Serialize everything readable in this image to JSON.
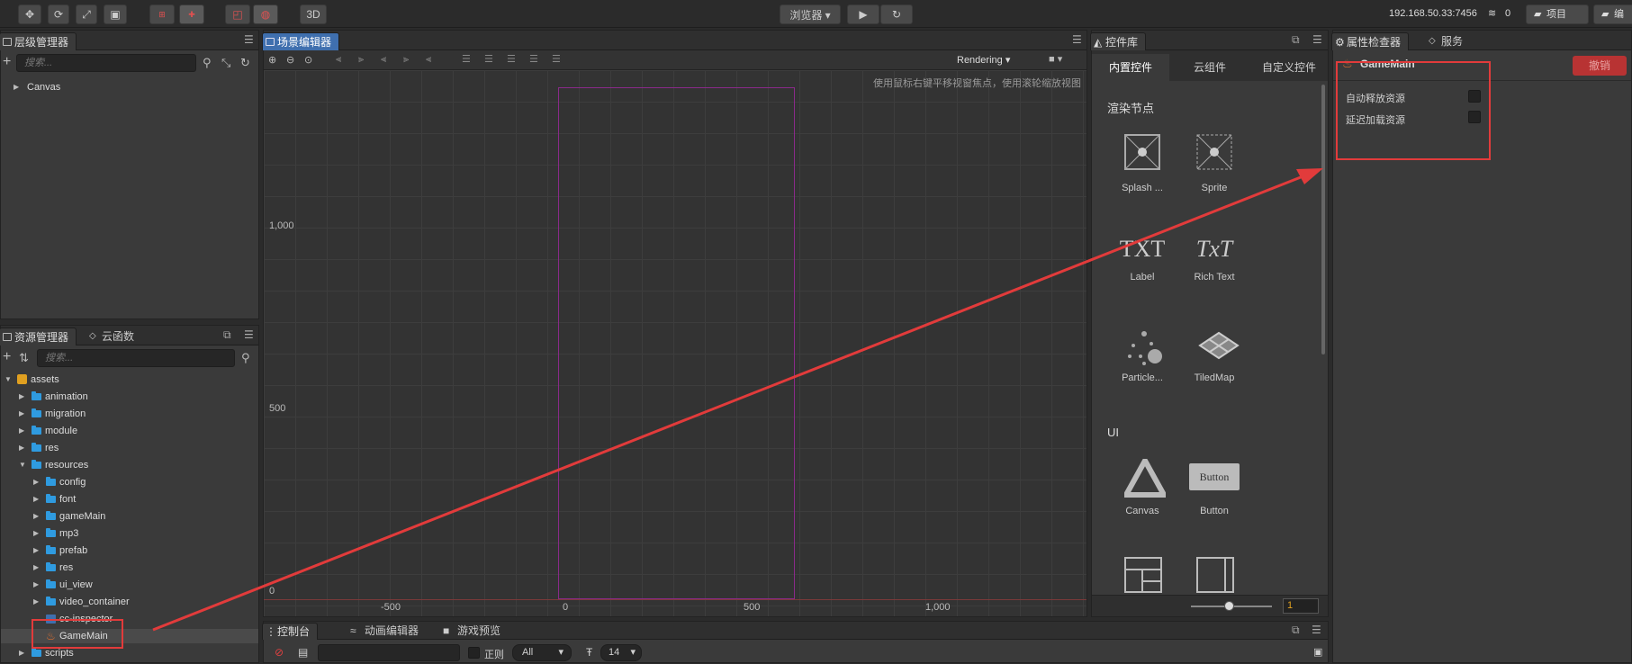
{
  "toolbar": {
    "btn_3d": "3D",
    "browser_label": "浏览器 ▾",
    "ip": "192.168.50.33:7456",
    "wifi_count": "0",
    "project_label": "项目",
    "edit_label": "编"
  },
  "hierarchy": {
    "tab": "层级管理器",
    "search_placeholder": "搜索...",
    "root_node": "Canvas"
  },
  "assets": {
    "tab": "资源管理器",
    "tab2": "云函数",
    "search_placeholder": "搜索...",
    "items": [
      {
        "label": "assets",
        "depth": 0,
        "expanded": true,
        "type": "root"
      },
      {
        "label": "animation",
        "depth": 1,
        "expanded": false,
        "type": "folder"
      },
      {
        "label": "migration",
        "depth": 1,
        "expanded": false,
        "type": "folder"
      },
      {
        "label": "module",
        "depth": 1,
        "expanded": false,
        "type": "folder"
      },
      {
        "label": "res",
        "depth": 1,
        "expanded": false,
        "type": "folder"
      },
      {
        "label": "resources",
        "depth": 1,
        "expanded": true,
        "type": "folder"
      },
      {
        "label": "config",
        "depth": 2,
        "expanded": false,
        "type": "folder"
      },
      {
        "label": "font",
        "depth": 2,
        "expanded": false,
        "type": "folder"
      },
      {
        "label": "gameMain",
        "depth": 2,
        "expanded": false,
        "type": "folder"
      },
      {
        "label": "mp3",
        "depth": 2,
        "expanded": false,
        "type": "folder"
      },
      {
        "label": "prefab",
        "depth": 2,
        "expanded": false,
        "type": "folder"
      },
      {
        "label": "res",
        "depth": 2,
        "expanded": false,
        "type": "folder"
      },
      {
        "label": "ui_view",
        "depth": 2,
        "expanded": false,
        "type": "folder"
      },
      {
        "label": "video_container",
        "depth": 2,
        "expanded": false,
        "type": "folder"
      },
      {
        "label": "cc-inspector",
        "depth": 2,
        "expanded": null,
        "type": "ts"
      },
      {
        "label": "GameMain",
        "depth": 2,
        "expanded": null,
        "type": "fire"
      },
      {
        "label": "scripts",
        "depth": 1,
        "expanded": false,
        "type": "folder"
      }
    ]
  },
  "scene": {
    "tab": "场景编辑器",
    "rendering": "Rendering",
    "hint": "使用鼠标右键平移视窗焦点，使用滚轮缩放视图",
    "y_labels": [
      "1,000",
      "500",
      "0"
    ],
    "x_labels": [
      "-500",
      "0",
      "500",
      "1,000"
    ]
  },
  "library": {
    "tab": "控件库",
    "tabs": [
      "内置控件",
      "云组件",
      "自定义控件"
    ],
    "section_render": "渲染节点",
    "section_ui": "UI",
    "items": [
      "Splash ...",
      "Sprite",
      "Label",
      "Rich Text",
      "Particle...",
      "TiledMap",
      "Canvas",
      "Button"
    ],
    "button_text": "Button",
    "txt_glyph": "TXT",
    "richtxt_glyph": "TxT",
    "zoom_value": "1"
  },
  "inspector": {
    "tab": "属性检查器",
    "tab2": "服务",
    "title": "GameMain",
    "revert": "撤销",
    "props": [
      "自动释放资源",
      "延迟加载资源"
    ]
  },
  "console": {
    "tabs": [
      "控制台",
      "动画编辑器",
      "游戏预览"
    ],
    "regex_label": "正则",
    "level": "All",
    "font_size": "14"
  },
  "colors": {
    "accent_blue": "#3f6fae",
    "folder": "#2f9be0",
    "annotation_red": "#e23b3b",
    "canvas_border": "#8a2a8a"
  }
}
